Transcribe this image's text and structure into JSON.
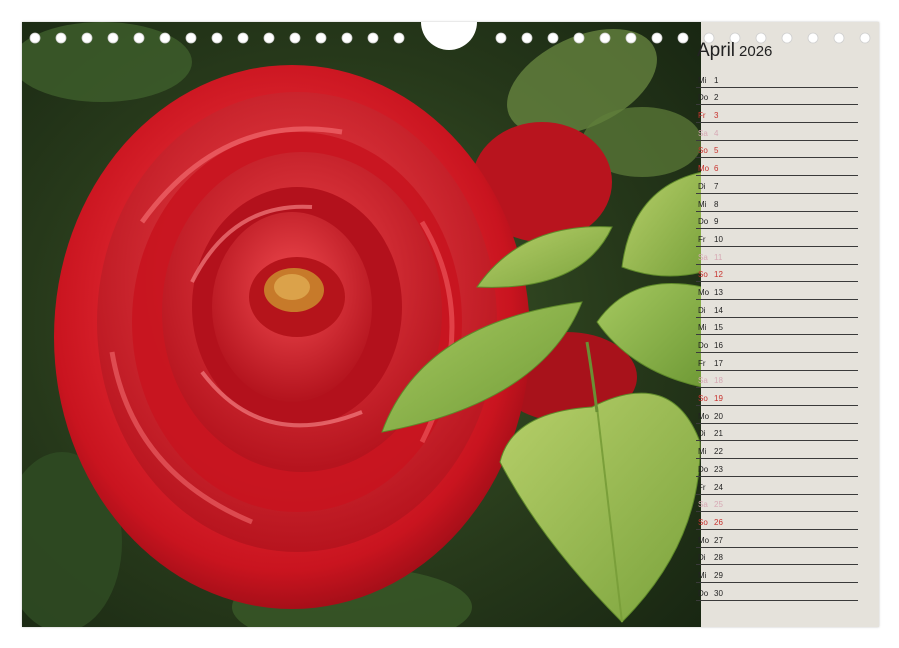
{
  "calendar": {
    "month": "April",
    "year": "2026",
    "days": [
      {
        "wd": "Mi",
        "d": "1",
        "type": "weekday"
      },
      {
        "wd": "Do",
        "d": "2",
        "type": "weekday"
      },
      {
        "wd": "Fr",
        "d": "3",
        "type": "holiday"
      },
      {
        "wd": "Sa",
        "d": "4",
        "type": "saturday"
      },
      {
        "wd": "So",
        "d": "5",
        "type": "sunday"
      },
      {
        "wd": "Mo",
        "d": "6",
        "type": "holiday"
      },
      {
        "wd": "Di",
        "d": "7",
        "type": "weekday"
      },
      {
        "wd": "Mi",
        "d": "8",
        "type": "weekday"
      },
      {
        "wd": "Do",
        "d": "9",
        "type": "weekday"
      },
      {
        "wd": "Fr",
        "d": "10",
        "type": "weekday"
      },
      {
        "wd": "Sa",
        "d": "11",
        "type": "saturday"
      },
      {
        "wd": "So",
        "d": "12",
        "type": "sunday"
      },
      {
        "wd": "Mo",
        "d": "13",
        "type": "weekday"
      },
      {
        "wd": "Di",
        "d": "14",
        "type": "weekday"
      },
      {
        "wd": "Mi",
        "d": "15",
        "type": "weekday"
      },
      {
        "wd": "Do",
        "d": "16",
        "type": "weekday"
      },
      {
        "wd": "Fr",
        "d": "17",
        "type": "weekday"
      },
      {
        "wd": "Sa",
        "d": "18",
        "type": "saturday"
      },
      {
        "wd": "So",
        "d": "19",
        "type": "sunday"
      },
      {
        "wd": "Mo",
        "d": "20",
        "type": "weekday"
      },
      {
        "wd": "Di",
        "d": "21",
        "type": "weekday"
      },
      {
        "wd": "Mi",
        "d": "22",
        "type": "weekday"
      },
      {
        "wd": "Do",
        "d": "23",
        "type": "weekday"
      },
      {
        "wd": "Fr",
        "d": "24",
        "type": "weekday"
      },
      {
        "wd": "Sa",
        "d": "25",
        "type": "saturday"
      },
      {
        "wd": "So",
        "d": "26",
        "type": "sunday"
      },
      {
        "wd": "Mo",
        "d": "27",
        "type": "weekday"
      },
      {
        "wd": "Di",
        "d": "28",
        "type": "weekday"
      },
      {
        "wd": "Mi",
        "d": "29",
        "type": "weekday"
      },
      {
        "wd": "Do",
        "d": "30",
        "type": "weekday"
      }
    ]
  },
  "colors": {
    "rose": "#d4202a",
    "leaf": "#8fb84a",
    "sunday": "#c8312d",
    "saturday": "#d7a8b4"
  },
  "photo": {
    "subject": "red-rose-with-leaves"
  }
}
